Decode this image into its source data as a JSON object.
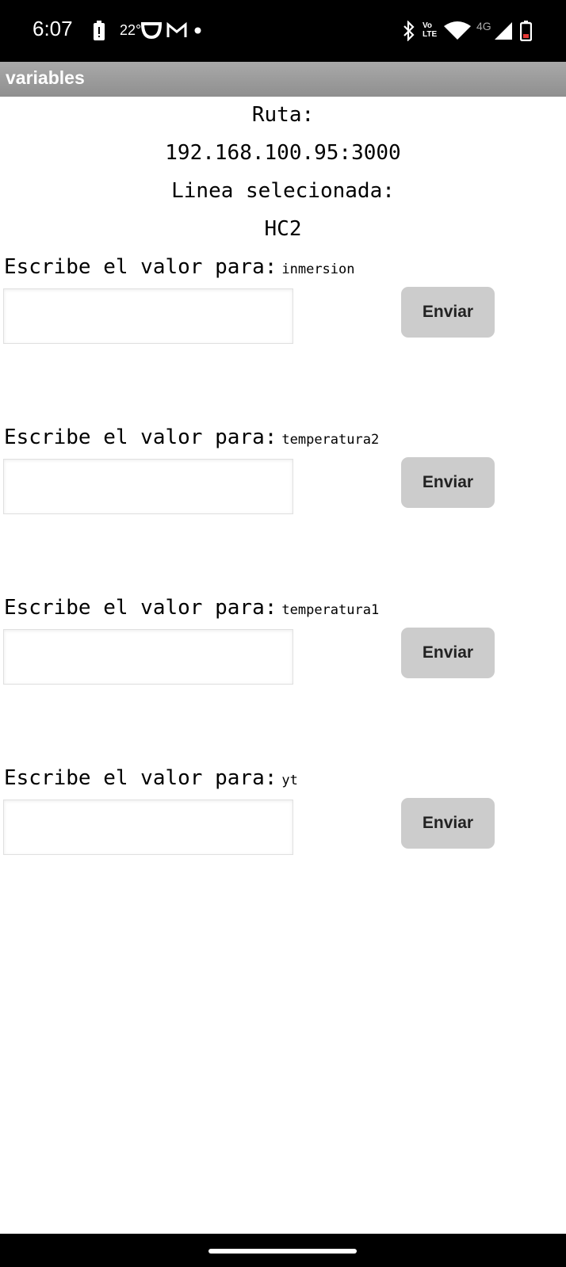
{
  "status_bar": {
    "time": "6:07",
    "temperature": "22°",
    "network_type": "4G",
    "volte": "Vo LTE",
    "icons": [
      "alert-battery-icon",
      "hourglass-icon",
      "gmail-icon",
      "dot-icon",
      "bluetooth-icon",
      "volte-icon",
      "wifi-icon",
      "signal-icon",
      "battery-icon"
    ]
  },
  "app_bar": {
    "title": "variables"
  },
  "info": {
    "route_label": "Ruta:",
    "route_value": "192.168.100.95:3000",
    "line_label": "Linea selecionada:",
    "line_value": "HC2"
  },
  "fields": [
    {
      "label": "Escribe el valor para:",
      "variable": "inmersion",
      "value": "",
      "button": "Enviar"
    },
    {
      "label": "Escribe el valor para:",
      "variable": "temperatura2",
      "value": "",
      "button": "Enviar"
    },
    {
      "label": "Escribe el valor para:",
      "variable": "temperatura1",
      "value": "",
      "button": "Enviar"
    },
    {
      "label": "Escribe el valor para:",
      "variable": "yt",
      "value": "",
      "button": "Enviar"
    }
  ],
  "colors": {
    "app_bar": "#999999",
    "button": "#cccccc",
    "status_bar": "#000000"
  }
}
